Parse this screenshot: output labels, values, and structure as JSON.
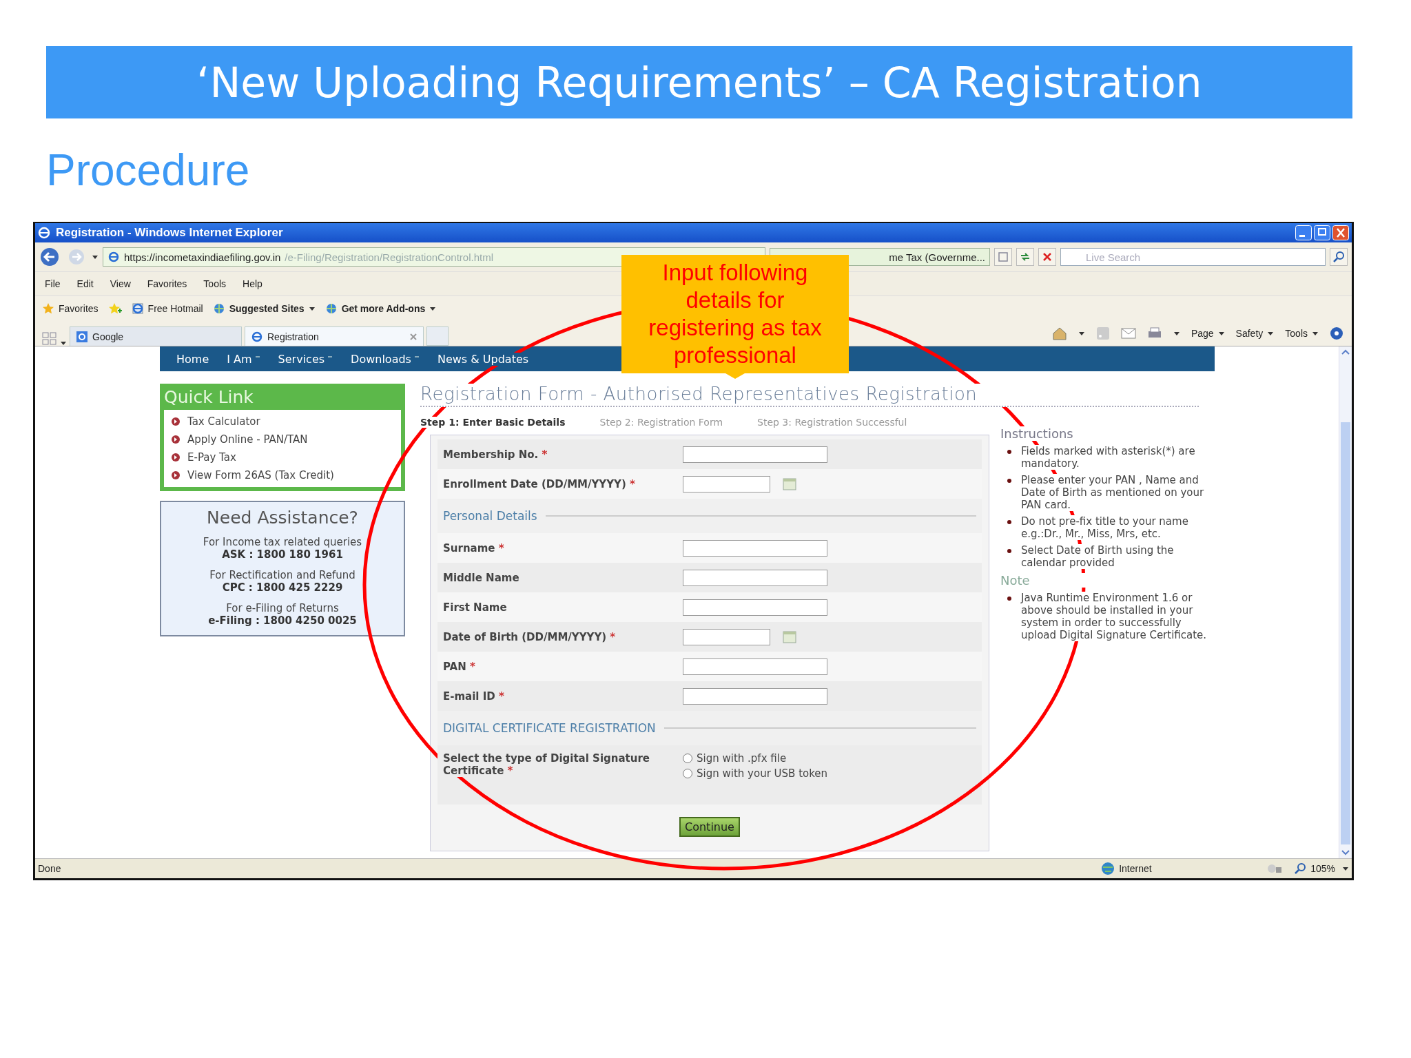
{
  "slide": {
    "title": "‘New Uploading Requirements’ – CA Registration",
    "subtitle": "Procedure"
  },
  "browser": {
    "title": "Registration - Windows Internet Explorer",
    "address": {
      "url": "https://incometaxindiaefiling.gov.in",
      "url_path": "/e-Filing/Registration/RegistrationControl.html",
      "page_title": "me Tax (Governme..."
    },
    "search": {
      "placeholder": "Live Search"
    },
    "menu": [
      "File",
      "Edit",
      "View",
      "Favorites",
      "Tools",
      "Help"
    ],
    "favorites_bar": [
      {
        "label": "Favorites",
        "kind": "star"
      },
      {
        "label": "Free Hotmail",
        "kind": "page"
      },
      {
        "label": "Suggested Sites",
        "kind": "dropdown"
      },
      {
        "label": "Get more Add-ons",
        "kind": "dropdown"
      }
    ],
    "tabs": [
      {
        "label": "Google",
        "selected": false
      },
      {
        "label": "Registration",
        "selected": true
      }
    ],
    "command_bar": [
      "Page",
      "Safety",
      "Tools"
    ],
    "status_bar": {
      "text": "Done",
      "zone": "Internet",
      "zoom": "105%"
    }
  },
  "site": {
    "nav": [
      {
        "label": "Home",
        "dropdown": false
      },
      {
        "label": "I Am",
        "dropdown": true
      },
      {
        "label": "Services",
        "dropdown": true
      },
      {
        "label": "Downloads",
        "dropdown": true
      },
      {
        "label": "News & Updates",
        "dropdown": false
      }
    ],
    "quick_link": {
      "title": "Quick Link",
      "items": [
        "Tax Calculator",
        "Apply Online - PAN/TAN",
        "E-Pay Tax",
        "View Form 26AS (Tax Credit)"
      ]
    },
    "assistance": {
      "title": "Need Assistance?",
      "contacts": [
        {
          "label": "For Income tax related queries",
          "number": "ASK : 1800 180 1961"
        },
        {
          "label": "For Rectification and Refund",
          "number": "CPC : 1800 425 2229"
        },
        {
          "label": "For e-Filing of Returns",
          "number": "e-Filing : 1800 4250 0025"
        }
      ]
    },
    "form": {
      "heading": "Registration Form - Authorised Representatives Registration",
      "steps": [
        {
          "label": "Step 1: Enter Basic Details",
          "selected": true
        },
        {
          "label": "Step 2: Registration Form",
          "selected": false
        },
        {
          "label": "Step 3: Registration Successful",
          "selected": false
        }
      ],
      "rows": [
        {
          "kind": "text",
          "label": "Membership No.",
          "asterisk": "*"
        },
        {
          "kind": "date",
          "label": "Enrollment Date (DD/MM/YYYY)",
          "asterisk": "*"
        },
        {
          "kind": "section",
          "label": "Personal Details"
        },
        {
          "kind": "text",
          "label": "Surname",
          "asterisk": "*"
        },
        {
          "kind": "text",
          "label": "Middle Name"
        },
        {
          "kind": "text",
          "label": "First Name"
        },
        {
          "kind": "date",
          "label": "Date of Birth (DD/MM/YYYY)",
          "asterisk": "*"
        },
        {
          "kind": "text",
          "label": "PAN",
          "asterisk": "*"
        },
        {
          "kind": "text",
          "label": "E-mail ID",
          "asterisk": "*"
        },
        {
          "kind": "section",
          "label": "DIGITAL CERTIFICATE REGISTRATION"
        },
        {
          "kind": "radio",
          "label": "Select the type of Digital Signature Certificate",
          "asterisk": "*",
          "options": [
            {
              "label": "Sign with .pfx file",
              "checked": false
            },
            {
              "label": "Sign with your USB token",
              "checked": false
            }
          ]
        }
      ],
      "button": "Continue"
    },
    "instructions": {
      "title": "Instructions",
      "items": [
        "Fields marked with asterisk(*) are mandatory.",
        "Please enter your PAN , Name and Date of Birth as mentioned on your PAN card.",
        "Do not pre-fix title to your name e.g.:Dr., Mr., Miss, Mrs, etc.",
        "Select Date of Birth using the calendar provided"
      ],
      "note_title": "Note",
      "notes": [
        "Java Runtime Environment 1.6 or above should be installed in your system in order to successfully upload Digital Signature Certificate."
      ]
    }
  },
  "callout": {
    "text": "Input following details for registering as tax professional"
  }
}
